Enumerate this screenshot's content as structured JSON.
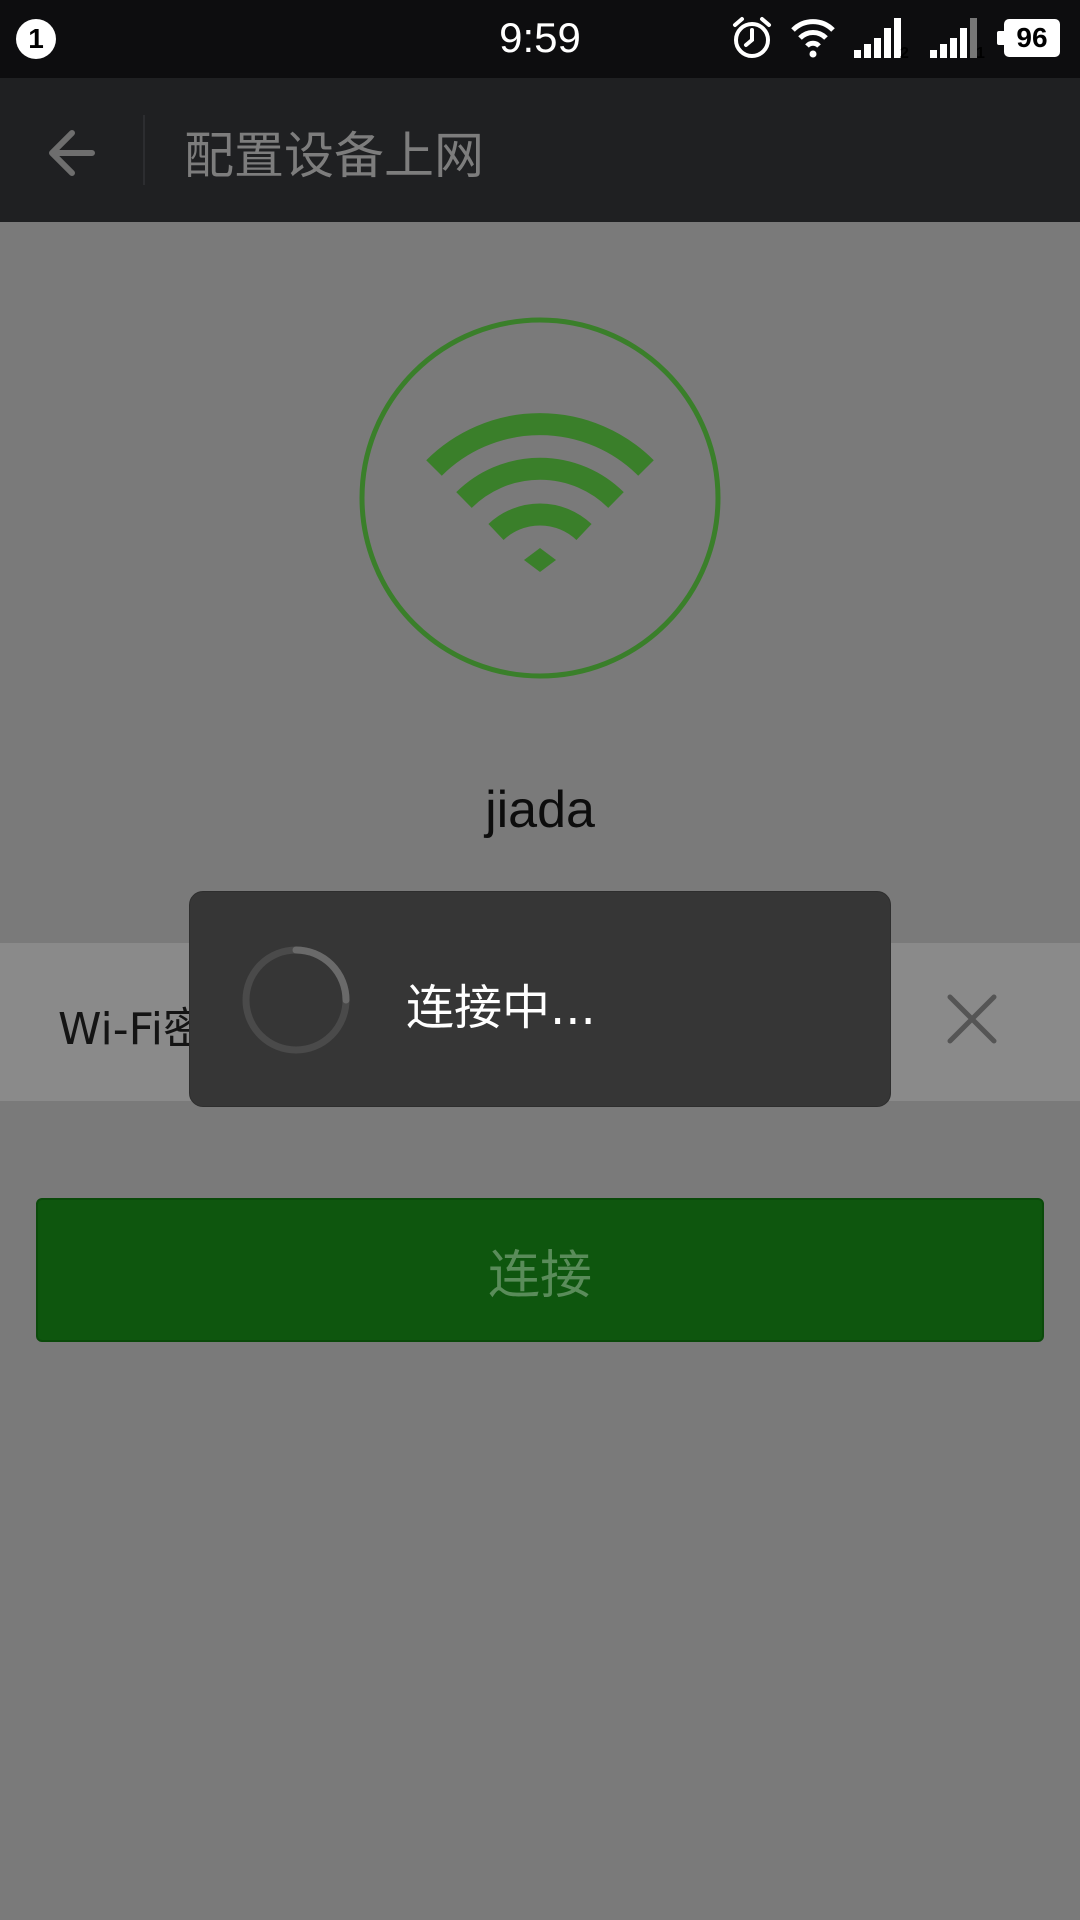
{
  "status_bar": {
    "notification_count": "1",
    "time": "9:59",
    "sim1_label": "2",
    "sim2_label": "1",
    "battery": "96",
    "icons": [
      "alarm-icon",
      "wifi-icon",
      "signal-icon",
      "signal-icon"
    ]
  },
  "header": {
    "title": "配置设备上网",
    "back_icon": "back-arrow-icon"
  },
  "network": {
    "ssid": "jiada",
    "password_label": "Wi-Fi密码",
    "password_value": "●●●●●●●●●●"
  },
  "actions": {
    "connect_label": "连接"
  },
  "dialog": {
    "message": "连接中..."
  },
  "colors": {
    "accent_green": "#3a7f2a",
    "button_green": "#0e560e",
    "overlay_bg": "#7a7a7a",
    "dialog_bg": "#363636"
  }
}
